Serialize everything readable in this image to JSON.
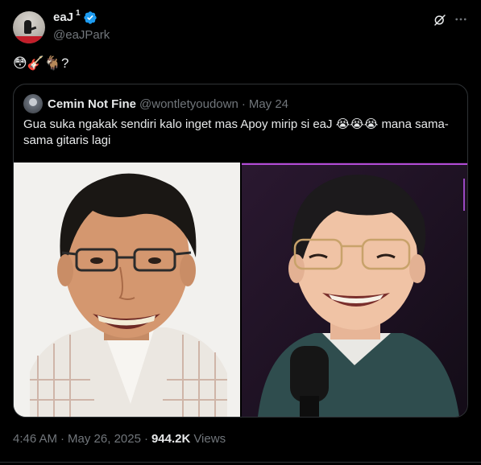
{
  "author": {
    "display_name": "eaJ",
    "superscript": "1",
    "handle": "@eaJPark",
    "verified": true,
    "avatar_icon": "avatar-image"
  },
  "actions": {
    "grok_icon": "grok-icon",
    "more_icon": "more-icon"
  },
  "tweet": {
    "text": "😳🎸🐐?"
  },
  "quote": {
    "display_name": "Cemin Not Fine",
    "handle": "@wontletyoudown",
    "separator": "·",
    "date": "May 24",
    "text": "Gua suka ngakak sendiri kalo inget mas Apoy mirip si eaJ 😭😭😭 mana sama-sama gitaris lagi",
    "images": [
      "photo-left",
      "photo-right"
    ]
  },
  "footer": {
    "time": "4:46 AM",
    "sep1": "·",
    "date": "May 26, 2025",
    "sep2": "·",
    "views_count": "944.2K",
    "views_label": "Views"
  },
  "colors": {
    "background": "#000000",
    "text": "#e7e9ea",
    "muted": "#71767b",
    "border": "#2f3336",
    "verified": "#1d9bf0"
  }
}
